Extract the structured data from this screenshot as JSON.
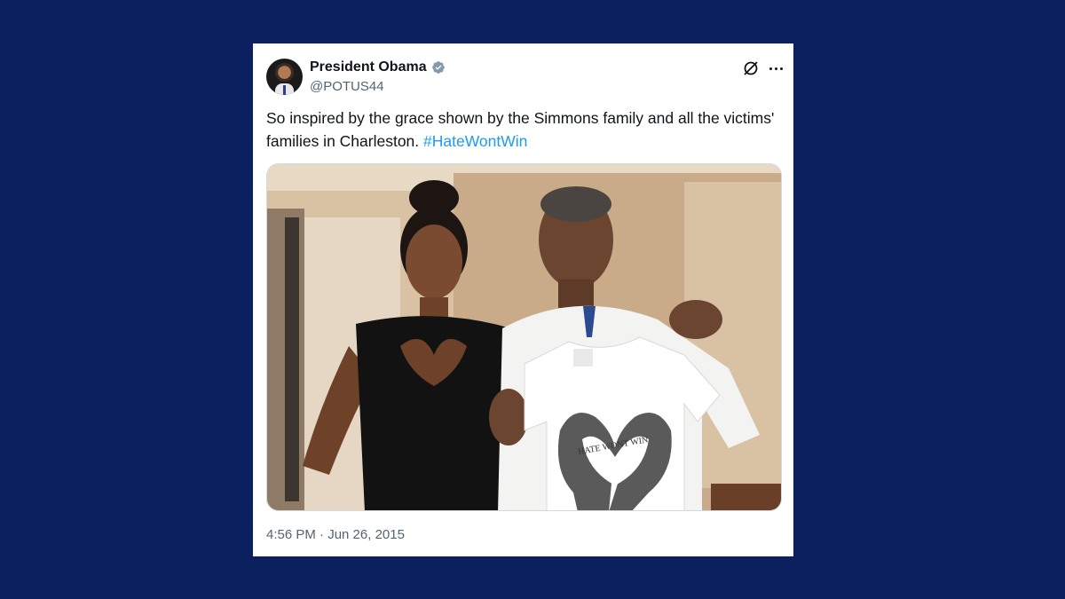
{
  "tweet": {
    "author_name": "President Obama",
    "author_handle": "@POTUS44",
    "text_before": "So inspired by the grace shown by the Simmons family and all the victims' families in Charleston. ",
    "hashtag": "#HateWontWin",
    "timestamp": "4:56 PM · Jun 26, 2015",
    "shirt_print": "HATE WONT WIN",
    "icons": {
      "verified": "verified-badge-icon",
      "grok": "grok-icon",
      "more": "more-options-icon"
    }
  },
  "colors": {
    "background": "#0c1f5f",
    "card": "#ffffff",
    "primary_text": "#0f1419",
    "secondary_text": "#536471",
    "link": "#1d9bf0"
  }
}
